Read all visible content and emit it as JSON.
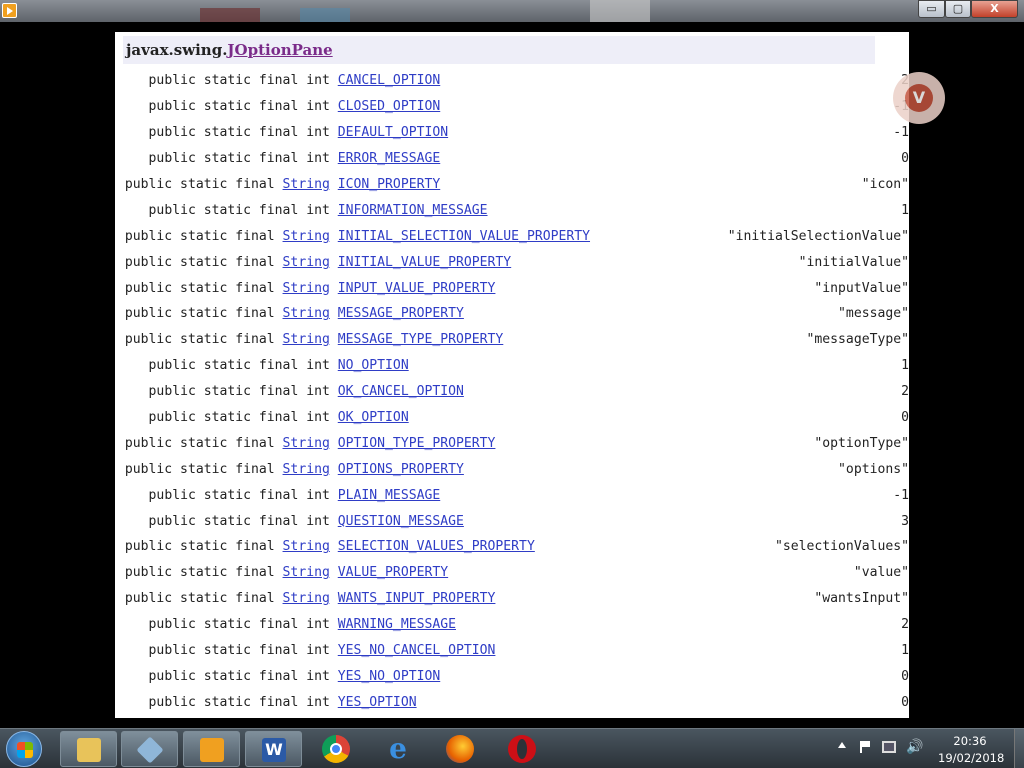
{
  "doc": {
    "package": "javax.swing.",
    "class_name": "JOptionPane",
    "fields": [
      {
        "modifier": "public static final int",
        "type": "",
        "name": "CANCEL_OPTION",
        "value": "2"
      },
      {
        "modifier": "public static final int",
        "type": "",
        "name": "CLOSED_OPTION",
        "value": "-1"
      },
      {
        "modifier": "public static final int",
        "type": "",
        "name": "DEFAULT_OPTION",
        "value": "-1"
      },
      {
        "modifier": "public static final int",
        "type": "",
        "name": "ERROR_MESSAGE",
        "value": "0"
      },
      {
        "modifier": "public static final",
        "type": "String",
        "name": "ICON_PROPERTY",
        "value": "\"icon\""
      },
      {
        "modifier": "public static final int",
        "type": "",
        "name": "INFORMATION_MESSAGE",
        "value": "1"
      },
      {
        "modifier": "public static final",
        "type": "String",
        "name": "INITIAL_SELECTION_VALUE_PROPERTY",
        "value": "\"initialSelectionValue\""
      },
      {
        "modifier": "public static final",
        "type": "String",
        "name": "INITIAL_VALUE_PROPERTY",
        "value": "\"initialValue\""
      },
      {
        "modifier": "public static final",
        "type": "String",
        "name": "INPUT_VALUE_PROPERTY",
        "value": "\"inputValue\""
      },
      {
        "modifier": "public static final",
        "type": "String",
        "name": "MESSAGE_PROPERTY",
        "value": "\"message\""
      },
      {
        "modifier": "public static final",
        "type": "String",
        "name": "MESSAGE_TYPE_PROPERTY",
        "value": "\"messageType\""
      },
      {
        "modifier": "public static final int",
        "type": "",
        "name": "NO_OPTION",
        "value": "1"
      },
      {
        "modifier": "public static final int",
        "type": "",
        "name": "OK_CANCEL_OPTION",
        "value": "2"
      },
      {
        "modifier": "public static final int",
        "type": "",
        "name": "OK_OPTION",
        "value": "0"
      },
      {
        "modifier": "public static final",
        "type": "String",
        "name": "OPTION_TYPE_PROPERTY",
        "value": "\"optionType\""
      },
      {
        "modifier": "public static final",
        "type": "String",
        "name": "OPTIONS_PROPERTY",
        "value": "\"options\""
      },
      {
        "modifier": "public static final int",
        "type": "",
        "name": "PLAIN_MESSAGE",
        "value": "-1"
      },
      {
        "modifier": "public static final int",
        "type": "",
        "name": "QUESTION_MESSAGE",
        "value": "3"
      },
      {
        "modifier": "public static final",
        "type": "String",
        "name": "SELECTION_VALUES_PROPERTY",
        "value": "\"selectionValues\""
      },
      {
        "modifier": "public static final",
        "type": "String",
        "name": "VALUE_PROPERTY",
        "value": "\"value\""
      },
      {
        "modifier": "public static final",
        "type": "String",
        "name": "WANTS_INPUT_PROPERTY",
        "value": "\"wantsInput\""
      },
      {
        "modifier": "public static final int",
        "type": "",
        "name": "WARNING_MESSAGE",
        "value": "2"
      },
      {
        "modifier": "public static final int",
        "type": "",
        "name": "YES_NO_CANCEL_OPTION",
        "value": "1"
      },
      {
        "modifier": "public static final int",
        "type": "",
        "name": "YES_NO_OPTION",
        "value": "0"
      },
      {
        "modifier": "public static final int",
        "type": "",
        "name": "YES_OPTION",
        "value": "0"
      }
    ]
  },
  "window": {
    "minimize_glyph": "▭",
    "maximize_glyph": "▢",
    "close_glyph": "X"
  },
  "taskbar": {
    "pinned": [
      {
        "name": "explorer",
        "icon": "folder-icon"
      },
      {
        "name": "box",
        "icon": "virtualbox-icon"
      },
      {
        "name": "media",
        "icon": "media-player-icon"
      },
      {
        "name": "word",
        "icon": "word-icon",
        "glyph": "W"
      },
      {
        "name": "chrome",
        "icon": "chrome-icon"
      },
      {
        "name": "ie",
        "icon": "internet-explorer-icon",
        "glyph": "e"
      },
      {
        "name": "firefox",
        "icon": "firefox-icon"
      },
      {
        "name": "opera",
        "icon": "opera-icon"
      }
    ],
    "clock_time": "20:36",
    "clock_date": "19/02/2018",
    "volume_glyph": "🔊"
  },
  "colors": {
    "link": "#2f3dc6",
    "class_name": "#7a2b89",
    "header_bg": "#eeeef8"
  }
}
